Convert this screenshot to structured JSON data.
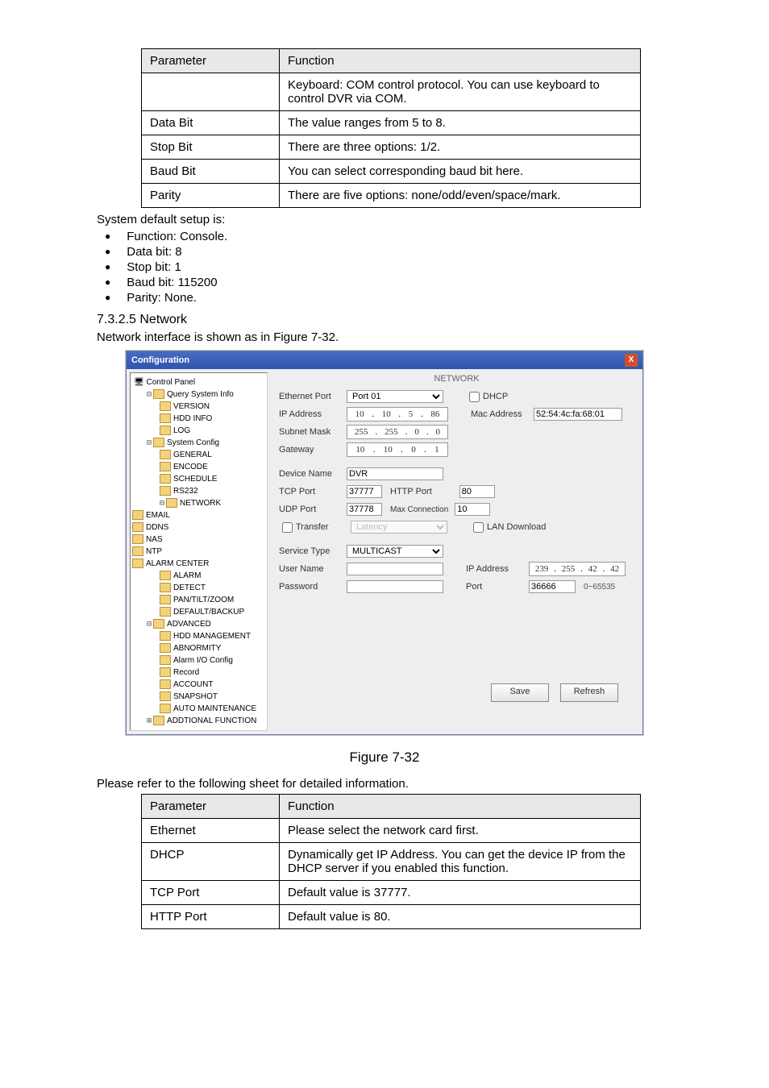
{
  "tables": {
    "top": {
      "headers": [
        "Parameter",
        "Function"
      ],
      "rows": [
        [
          "",
          "Keyboard: COM control protocol. You can use keyboard to control DVR via COM."
        ],
        [
          "Data Bit",
          "The value ranges from 5 to 8."
        ],
        [
          "Stop Bit",
          "There are three options: 1/2."
        ],
        [
          "Baud Bit",
          "You can select corresponding baud bit here."
        ],
        [
          "Parity",
          "There are five options: none/odd/even/space/mark."
        ]
      ]
    },
    "bottom": {
      "headers": [
        "Parameter",
        "Function"
      ],
      "rows": [
        [
          "Ethernet",
          "Please select the network card first."
        ],
        [
          "DHCP",
          "Dynamically get IP Address. You can get the device IP from the DHCP server if you enabled this function."
        ],
        [
          "TCP Port",
          "Default value is 37777."
        ],
        [
          "HTTP  Port",
          "Default value is 80."
        ]
      ]
    }
  },
  "text": {
    "default_setup": "System default setup is:",
    "bullets": [
      "Function: Console.",
      "Data bit: 8",
      "Stop bit: 1",
      "Baud bit: 115200",
      "Parity: None."
    ],
    "section": "7.3.2.5  Network",
    "network_intro": "Network interface is shown as in Figure 7-32.",
    "fig_caption": "Figure 7-32",
    "refer_sheet": "Please refer to the following sheet for detailed information."
  },
  "win": {
    "title": "Configuration",
    "close": "X",
    "panel_title": "NETWORK",
    "tree": {
      "root": "Control Panel",
      "nodes": [
        {
          "level": 1,
          "label": "Query System Info",
          "toggle": "-"
        },
        {
          "level": 2,
          "label": "VERSION"
        },
        {
          "level": 2,
          "label": "HDD INFO"
        },
        {
          "level": 2,
          "label": "LOG"
        },
        {
          "level": 1,
          "label": "System Config",
          "toggle": "-"
        },
        {
          "level": 2,
          "label": "GENERAL"
        },
        {
          "level": 2,
          "label": "ENCODE"
        },
        {
          "level": 2,
          "label": "SCHEDULE"
        },
        {
          "level": 2,
          "label": "RS232"
        },
        {
          "level": 2,
          "label": "NETWORK",
          "toggle": "-",
          "selected": false
        },
        {
          "level": 3,
          "label": "EMAIL"
        },
        {
          "level": 3,
          "label": "DDNS"
        },
        {
          "level": 3,
          "label": "NAS"
        },
        {
          "level": 3,
          "label": "NTP"
        },
        {
          "level": 3,
          "label": "ALARM CENTER"
        },
        {
          "level": 2,
          "label": "ALARM"
        },
        {
          "level": 2,
          "label": "DETECT"
        },
        {
          "level": 2,
          "label": "PAN/TILT/ZOOM"
        },
        {
          "level": 2,
          "label": "DEFAULT/BACKUP"
        },
        {
          "level": 1,
          "label": "ADVANCED",
          "toggle": "-"
        },
        {
          "level": 2,
          "label": "HDD MANAGEMENT"
        },
        {
          "level": 2,
          "label": "ABNORMITY"
        },
        {
          "level": 2,
          "label": "Alarm I/O Config"
        },
        {
          "level": 2,
          "label": "Record"
        },
        {
          "level": 2,
          "label": "ACCOUNT"
        },
        {
          "level": 2,
          "label": "SNAPSHOT"
        },
        {
          "level": 2,
          "label": "AUTO MAINTENANCE"
        },
        {
          "level": 1,
          "label": "ADDTIONAL FUNCTION",
          "toggle": "+"
        }
      ]
    },
    "form": {
      "ethernet_port_lbl": "Ethernet Port",
      "ethernet_port_val": "Port 01",
      "dhcp_lbl": "DHCP",
      "ip_address_lbl": "IP Address",
      "ip_address_val": [
        "10",
        "10",
        "5",
        "86"
      ],
      "mac_address_lbl": "Mac Address",
      "mac_address_val": "52:54:4c:fa:68:01",
      "subnet_mask_lbl": "Subnet Mask",
      "subnet_mask_val": [
        "255",
        "255",
        "0",
        "0"
      ],
      "gateway_lbl": "Gateway",
      "gateway_val": [
        "10",
        "10",
        "0",
        "1"
      ],
      "device_name_lbl": "Device Name",
      "device_name_val": "DVR",
      "tcp_port_lbl": "TCP Port",
      "tcp_port_val": "37777",
      "http_port_lbl": "HTTP Port",
      "http_port_val": "80",
      "udp_port_lbl": "UDP Port",
      "udp_port_val": "37778",
      "max_connection_lbl": "Max Connection",
      "max_connection_val": "10",
      "transfer_lbl": "Transfer",
      "latency_lbl": "Latency",
      "lan_download_lbl": "LAN Download",
      "service_type_lbl": "Service Type",
      "service_type_val": "MULTICAST",
      "user_name_lbl": "User Name",
      "password_lbl": "Password",
      "ip_address2_lbl": "IP Address",
      "ip_address2_val": [
        "239",
        "255",
        "42",
        "42"
      ],
      "port_lbl": "Port",
      "port_val": "36666",
      "port_hint": "0~65535",
      "save_btn": "Save",
      "refresh_btn": "Refresh"
    }
  }
}
